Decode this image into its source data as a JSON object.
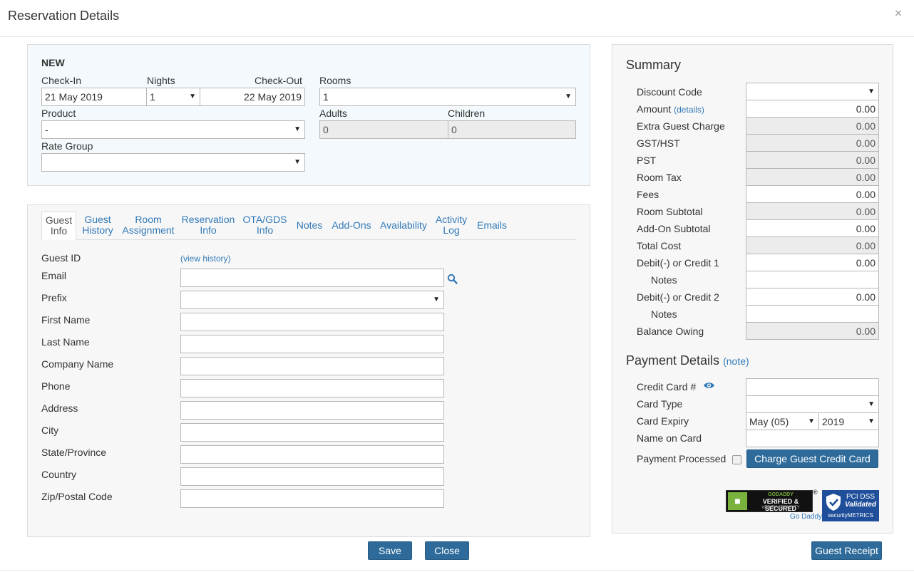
{
  "modal": {
    "title": "Reservation Details",
    "close_label": "×"
  },
  "booking": {
    "status": "NEW",
    "checkin_label": "Check-In",
    "checkin_value": "21 May 2019",
    "nights_label": "Nights",
    "nights_value": "1",
    "checkout_label": "Check-Out",
    "checkout_value": "22 May 2019",
    "rooms_label": "Rooms",
    "rooms_value": "1",
    "product_label": "Product",
    "product_value": "-",
    "adults_label": "Adults",
    "adults_value": "0",
    "children_label": "Children",
    "children_value": "0",
    "rate_group_label": "Rate Group",
    "rate_group_value": ""
  },
  "tabs": [
    {
      "line1": "Guest",
      "line2": "Info"
    },
    {
      "line1": "Guest",
      "line2": "History"
    },
    {
      "line1": "Room",
      "line2": "Assignment"
    },
    {
      "line1": "Reservation",
      "line2": "Info"
    },
    {
      "line1": "OTA/GDS",
      "line2": "Info"
    },
    {
      "line1": "Notes",
      "line2": ""
    },
    {
      "line1": "Add-Ons",
      "line2": ""
    },
    {
      "line1": "Availability",
      "line2": ""
    },
    {
      "line1": "Activity",
      "line2": "Log"
    },
    {
      "line1": "Emails",
      "line2": ""
    }
  ],
  "guest": {
    "guest_id_label": "Guest ID",
    "view_history_link": "(view history)",
    "fields": [
      {
        "label": "Email",
        "value": ""
      },
      {
        "label": "Prefix",
        "value": ""
      },
      {
        "label": "First Name",
        "value": ""
      },
      {
        "label": "Last Name",
        "value": ""
      },
      {
        "label": "Company Name",
        "value": ""
      },
      {
        "label": "Phone",
        "value": ""
      },
      {
        "label": "Address",
        "value": ""
      },
      {
        "label": "City",
        "value": ""
      },
      {
        "label": "State/Province",
        "value": ""
      },
      {
        "label": "Country",
        "value": ""
      },
      {
        "label": "Zip/Postal Code",
        "value": ""
      }
    ]
  },
  "summary": {
    "title": "Summary",
    "amount_details_link": "(details)",
    "rows": [
      {
        "label": "Discount Code",
        "value": ""
      },
      {
        "label": "Amount",
        "value": "0.00"
      },
      {
        "label": "Extra Guest Charge",
        "value": "0.00"
      },
      {
        "label": "GST/HST",
        "value": "0.00"
      },
      {
        "label": "PST",
        "value": "0.00"
      },
      {
        "label": "Room Tax",
        "value": "0.00"
      },
      {
        "label": "Fees",
        "value": "0.00"
      },
      {
        "label": "Room Subtotal",
        "value": "0.00"
      },
      {
        "label": "Add-On Subtotal",
        "value": "0.00"
      },
      {
        "label": "Total Cost",
        "value": "0.00"
      },
      {
        "label": "Debit(-) or Credit 1",
        "value": "0.00"
      },
      {
        "label": "Notes",
        "value": ""
      },
      {
        "label": "Debit(-) or Credit 2",
        "value": "0.00"
      },
      {
        "label": "Notes",
        "value": ""
      },
      {
        "label": "Balance Owing",
        "value": "0.00"
      }
    ]
  },
  "payment": {
    "title": "Payment Details",
    "note_link": "(note)",
    "card_number_label": "Credit Card #",
    "card_number_value": "",
    "card_type_label": "Card Type",
    "card_type_value": "",
    "card_expiry_label": "Card Expiry",
    "expiry_month_value": "May (05)",
    "expiry_year_value": "2019",
    "name_on_card_label": "Name on Card",
    "name_on_card_value": "",
    "processed_label": "Payment Processed",
    "charge_button": "Charge Guest Credit Card"
  },
  "badges": {
    "godaddy_line1": "GODADDY",
    "godaddy_line2": "VERIFIED & SECURED",
    "godaddy_line3": "VERIFY SECURITY",
    "godaddy_reg": "®",
    "godaddy_link": "Go Daddy",
    "pci_line1": "PCI DSS",
    "pci_line2": "Validated",
    "pci_line3": "securityMETRICS"
  },
  "footer": {
    "save_button": "Save",
    "close_button": "Close",
    "receipt_button": "Guest Receipt"
  },
  "colors": {
    "primary_button": "#2e6b9a",
    "link": "#337ab7",
    "booking_panel_bg": "#f3f9fc",
    "readonly_bg": "#ececec"
  }
}
